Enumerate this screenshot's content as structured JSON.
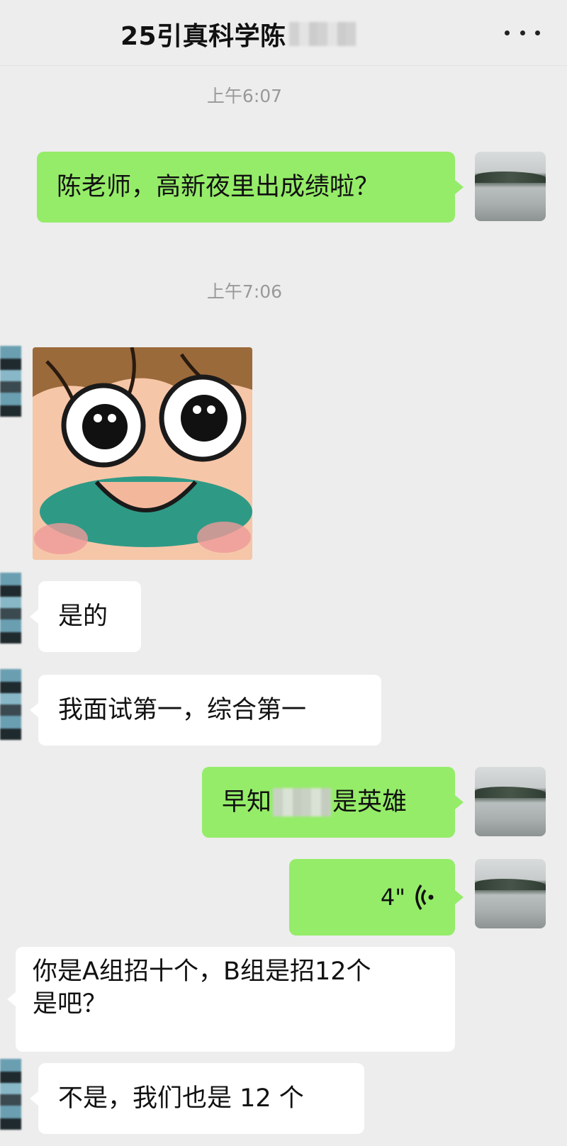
{
  "header": {
    "title": "25引真科学陈",
    "more_icon": "more-dots-icon"
  },
  "messages": {
    "time1": "上午6:07",
    "msg1": "陈老师，高新夜里出成绩啦？",
    "time2": "上午7:06",
    "sticker_icon": "cartoon-face-sticker",
    "msg2": "是的",
    "msg3": "我面试第一，综合第一",
    "msg4_before": "早知",
    "msg4_after": "是英雄",
    "voice_duration": "4\"",
    "msg5_line1": "你是A组招十个，B组是招12个",
    "msg5_line2": "是吧？",
    "msg6": "不是，我们也是 12 个"
  },
  "colors": {
    "background": "#ededed",
    "bubble_self": "#95ec69",
    "bubble_other": "#ffffff",
    "timestamp": "#999999"
  }
}
